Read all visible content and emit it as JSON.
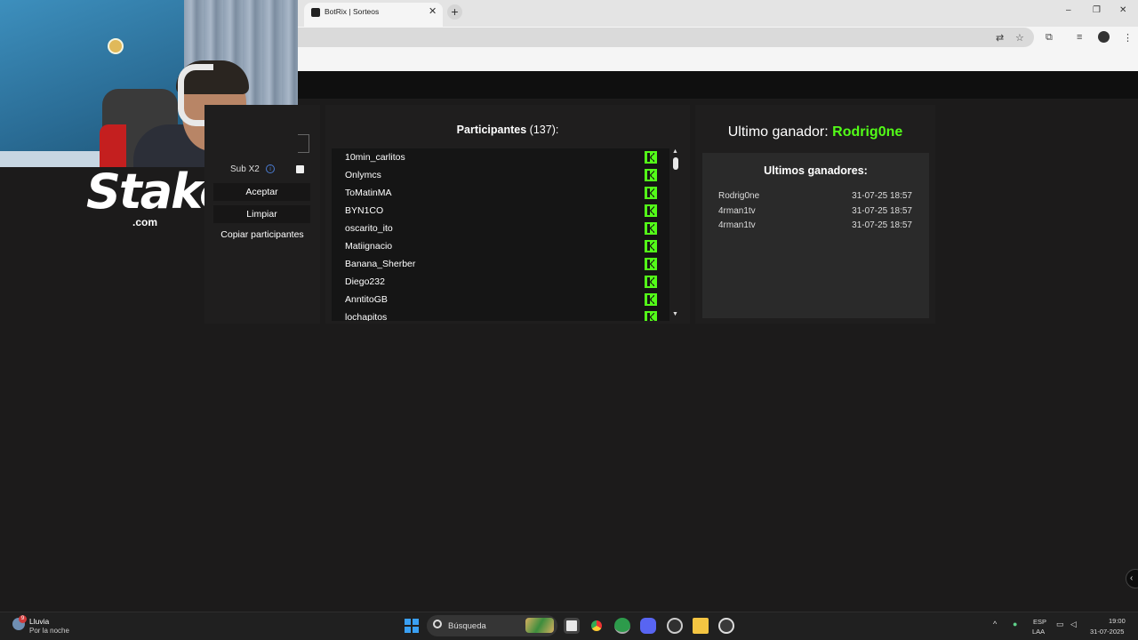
{
  "browser": {
    "tab_title": "BotRix | Sorteos",
    "tab_close": "✕",
    "new_tab": "+",
    "window_controls": [
      "–",
      "❐",
      "✕"
    ],
    "toolbar_icons": [
      "translate-icon",
      "star-icon",
      "extensions-icon",
      "media-icon",
      "profile-icon",
      "menu-icon"
    ]
  },
  "sponsor": {
    "logo_text": "Stake",
    "logo_suffix": ".com"
  },
  "controls": {
    "sub_label": "Sub X2",
    "info_glyph": "i",
    "accept_label": "Aceptar",
    "clear_label": "Limpiar",
    "copy_label": "Copiar participantes"
  },
  "participants": {
    "title": "Participantes",
    "count": "(137):",
    "names": [
      "10min_carlitos",
      "Onlymcs",
      "ToMatinMA",
      "BYN1CO",
      "oscarito_ito",
      "Matiignacio",
      "Banana_Sherber",
      "Diego232",
      "AnntitoGB",
      "lochapitos"
    ],
    "scroll_up": "▲",
    "scroll_down": "▼"
  },
  "winners": {
    "last_label": "Ultimo ganador:",
    "last_name": "Rodrig0ne",
    "list_title": "Ultimos ganadores:",
    "rows": [
      {
        "name": "Rodrig0ne",
        "date": "31-07-25 18:57"
      },
      {
        "name": "4rman1tv",
        "date": "31-07-25 18:57"
      },
      {
        "name": "4rman1tv",
        "date": "31-07-25 18:57"
      }
    ]
  },
  "side_toggle": "‹",
  "taskbar": {
    "weather_badge": "9",
    "weather_title": "Lluvia",
    "weather_sub": "Por la noche",
    "search_placeholder": "Búsqueda",
    "tray_chevron": "^",
    "lang_1": "ESP",
    "lang_2": "LAA",
    "time": "19:00",
    "date": "31-07-2025"
  },
  "colors": {
    "accent_green": "#53fc18",
    "background": "#1c1b1b",
    "panel": "#1f1e1e"
  }
}
